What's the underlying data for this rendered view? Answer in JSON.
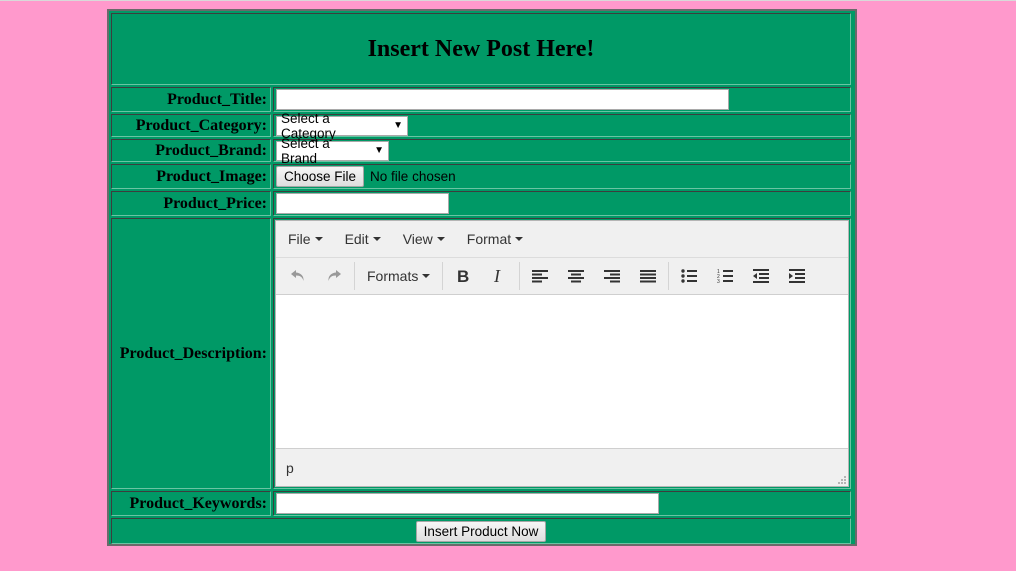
{
  "form": {
    "heading": "Insert New Post Here!",
    "fields": {
      "title_label": "Product_Title:",
      "category_label": "Product_Category:",
      "category_selected": "Select a Category",
      "brand_label": "Product_Brand:",
      "brand_selected": "Select a Brand",
      "image_label": "Product_Image:",
      "choose_file": "Choose File",
      "no_file": "No file chosen",
      "price_label": "Product_Price:",
      "description_label": "Product_Description:",
      "keywords_label": "Product_Keywords:"
    },
    "submit_label": "Insert Product Now"
  },
  "editor": {
    "menus": [
      "File",
      "Edit",
      "View",
      "Format"
    ],
    "formats_label": "Formats",
    "status_path": "p",
    "toolbar_icons": [
      "undo-icon",
      "redo-icon",
      "bold-icon",
      "italic-icon",
      "align-left-icon",
      "align-center-icon",
      "align-right-icon",
      "justify-icon",
      "bullet-list-icon",
      "numbered-list-icon",
      "outdent-icon",
      "indent-icon"
    ]
  },
  "colors": {
    "page_background": "#ff99cc",
    "form_background": "#009966",
    "editor_chrome": "#f0f0f0"
  }
}
